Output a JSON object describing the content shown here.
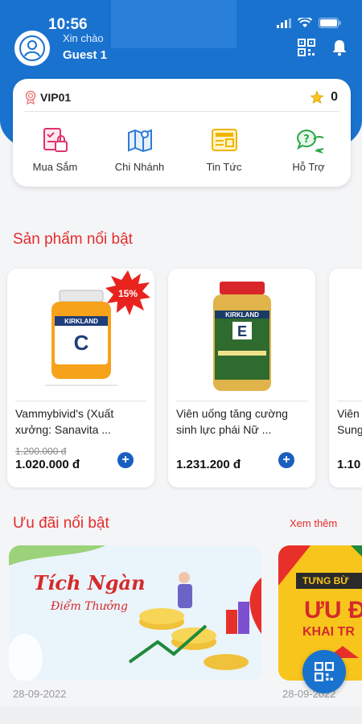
{
  "status": {
    "time": "10:56"
  },
  "header": {
    "greeting": "Xin chào",
    "user": "Guest 1"
  },
  "card": {
    "tier": "VIP01",
    "points": "0",
    "menu": [
      {
        "label": "Mua Sắm",
        "icon": "shopping-icon"
      },
      {
        "label": "Chi Nhánh",
        "icon": "map-icon"
      },
      {
        "label": "Tin Tức",
        "icon": "news-icon"
      },
      {
        "label": "Hỗ Trợ",
        "icon": "support-icon"
      }
    ]
  },
  "featured": {
    "title": "Sản phẩm nổi bật",
    "products": [
      {
        "name": "Vammybivid's (Xuất xưởng: Sanavita ...",
        "old_price": "1.200.000 đ",
        "price": "1.020.000 đ",
        "discount": "15%",
        "label_brand": "KIRKLAND",
        "label_letter": "C"
      },
      {
        "name": "Viên uống tăng cường sinh lực phái Nữ ...",
        "old_price": "",
        "price": "1.231.200 đ",
        "label_brand": "KIRKLAND",
        "label_letter": "E"
      },
      {
        "name": "Viên Sung",
        "old_price": "",
        "price": "1.10"
      }
    ]
  },
  "offers": {
    "title": "Ưu đãi nổi bật",
    "see_more": "Xem thêm",
    "items": [
      {
        "headline": "Tích Ngàn",
        "subline": "Điểm Thưởng",
        "date": "28-09-2022"
      },
      {
        "headline": "ƯU Đ",
        "subline": "KHAI TR",
        "top": "TƯNG BỪ",
        "date": "28-09-2022"
      }
    ]
  },
  "colors": {
    "primary": "#1a72cf",
    "accent": "#e42c2c"
  }
}
